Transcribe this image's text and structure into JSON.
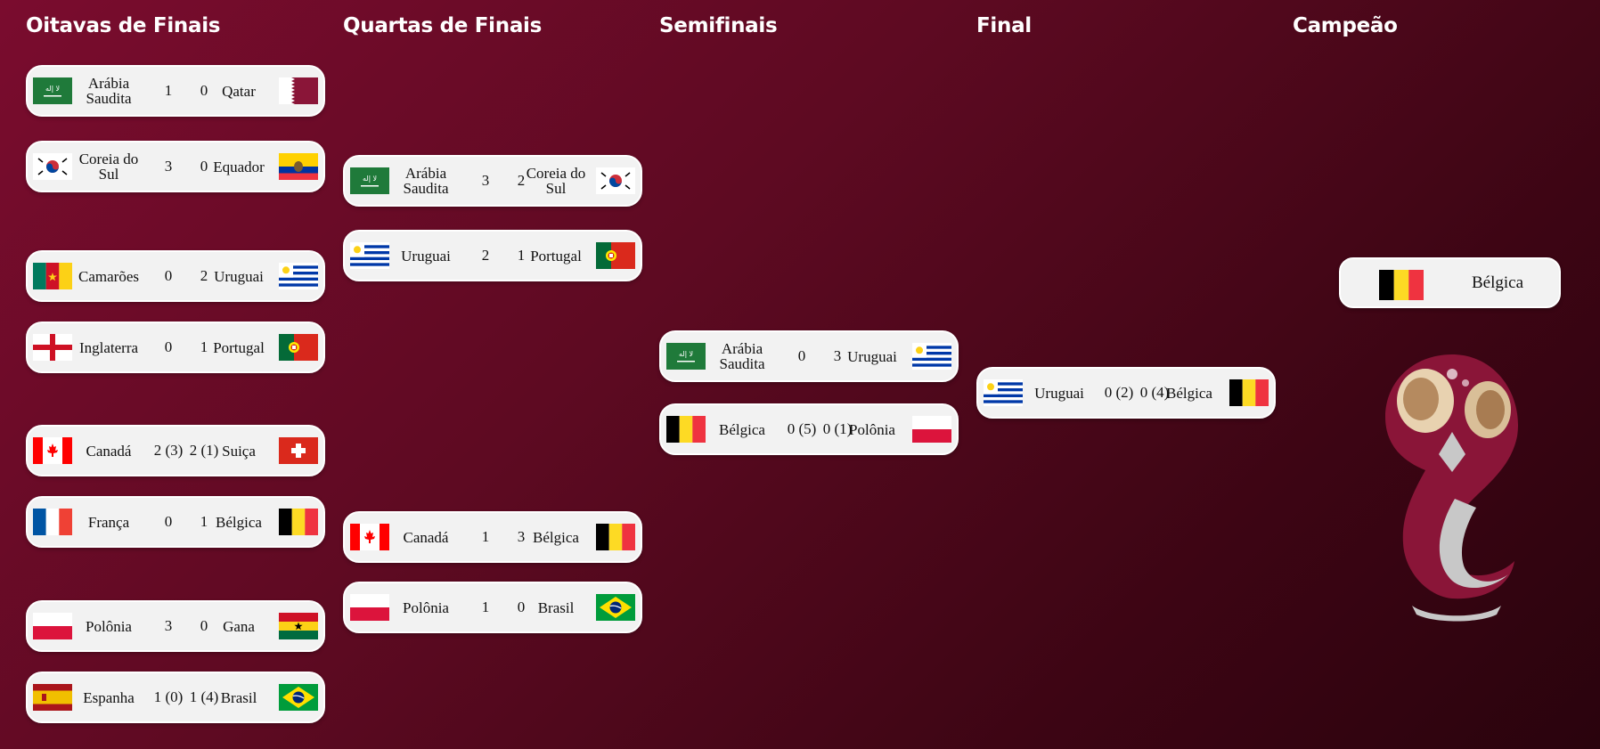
{
  "rounds": [
    "Oitavas de Finais",
    "Quartas de Finais",
    "Semifinais",
    "Final",
    "Campeão"
  ],
  "flags": {
    "ksa": {
      "name": "saudi-arabia-flag-icon",
      "colors": [
        "#1f7a3a",
        "#ffffff"
      ]
    },
    "qat": {
      "name": "qatar-flag-icon",
      "colors": [
        "#8a1538",
        "#ffffff"
      ]
    },
    "kor": {
      "name": "south-korea-flag-icon",
      "colors": [
        "#ffffff",
        "#cd2e3a",
        "#0047a0"
      ]
    },
    "ecu": {
      "name": "ecuador-flag-icon",
      "colors": [
        "#ffd100",
        "#0033a0",
        "#ef3340"
      ]
    },
    "cmr": {
      "name": "cameroon-flag-icon",
      "colors": [
        "#007a5e",
        "#ce1126",
        "#fcd116"
      ]
    },
    "uru": {
      "name": "uruguay-flag-icon",
      "colors": [
        "#ffffff",
        "#0038a8",
        "#fcd116"
      ]
    },
    "eng": {
      "name": "england-flag-icon",
      "colors": [
        "#ffffff",
        "#ce1124"
      ]
    },
    "por": {
      "name": "portugal-flag-icon",
      "colors": [
        "#046a38",
        "#da291c",
        "#ffe900"
      ]
    },
    "can": {
      "name": "canada-flag-icon",
      "colors": [
        "#ff0000",
        "#ffffff"
      ]
    },
    "sui": {
      "name": "switzerland-flag-icon",
      "colors": [
        "#da291c",
        "#ffffff"
      ]
    },
    "fra": {
      "name": "france-flag-icon",
      "colors": [
        "#0055a4",
        "#ffffff",
        "#ef4135"
      ]
    },
    "bel": {
      "name": "belgium-flag-icon",
      "colors": [
        "#000000",
        "#fdda24",
        "#ef3340"
      ]
    },
    "pol": {
      "name": "poland-flag-icon",
      "colors": [
        "#ffffff",
        "#dc143c"
      ]
    },
    "gha": {
      "name": "ghana-flag-icon",
      "colors": [
        "#ce1126",
        "#fcd116",
        "#006b3f",
        "#000000"
      ]
    },
    "esp": {
      "name": "spain-flag-icon",
      "colors": [
        "#aa151b",
        "#f1bf00"
      ]
    },
    "bra": {
      "name": "brazil-flag-icon",
      "colors": [
        "#009c3b",
        "#ffdf00",
        "#002776"
      ]
    }
  },
  "round_of_16": [
    {
      "home": "Arábia Saudita",
      "home_flag": "ksa",
      "home_score": "1",
      "away_score": "0",
      "away": "Qatar",
      "away_flag": "qat"
    },
    {
      "home": "Coreia do Sul",
      "home_flag": "kor",
      "home_score": "3",
      "away_score": "0",
      "away": "Equador",
      "away_flag": "ecu"
    },
    {
      "home": "Camarões",
      "home_flag": "cmr",
      "home_score": "0",
      "away_score": "2",
      "away": "Uruguai",
      "away_flag": "uru"
    },
    {
      "home": "Inglaterra",
      "home_flag": "eng",
      "home_score": "0",
      "away_score": "1",
      "away": "Portugal",
      "away_flag": "por"
    },
    {
      "home": "Canadá",
      "home_flag": "can",
      "home_score": "2 (3)",
      "away_score": "2 (1)",
      "away": "Suiça",
      "away_flag": "sui"
    },
    {
      "home": "França",
      "home_flag": "fra",
      "home_score": "0",
      "away_score": "1",
      "away": "Bélgica",
      "away_flag": "bel"
    },
    {
      "home": "Polônia",
      "home_flag": "pol",
      "home_score": "3",
      "away_score": "0",
      "away": "Gana",
      "away_flag": "gha"
    },
    {
      "home": "Espanha",
      "home_flag": "esp",
      "home_score": "1 (0)",
      "away_score": "1 (4)",
      "away": "Brasil",
      "away_flag": "bra"
    }
  ],
  "quarterfinals": [
    {
      "home": "Arábia Saudita",
      "home_flag": "ksa",
      "home_score": "3",
      "away_score": "2",
      "away": "Coreia do Sul",
      "away_flag": "kor"
    },
    {
      "home": "Uruguai",
      "home_flag": "uru",
      "home_score": "2",
      "away_score": "1",
      "away": "Portugal",
      "away_flag": "por"
    },
    {
      "home": "Canadá",
      "home_flag": "can",
      "home_score": "1",
      "away_score": "3",
      "away": "Bélgica",
      "away_flag": "bel"
    },
    {
      "home": "Polônia",
      "home_flag": "pol",
      "home_score": "1",
      "away_score": "0",
      "away": "Brasil",
      "away_flag": "bra"
    }
  ],
  "semifinals": [
    {
      "home": "Arábia Saudita",
      "home_flag": "ksa",
      "home_score": "0",
      "away_score": "3",
      "away": "Uruguai",
      "away_flag": "uru"
    },
    {
      "home": "Bélgica",
      "home_flag": "bel",
      "home_score": "0 (5)",
      "away_score": "0 (1)",
      "away": "Polônia",
      "away_flag": "pol"
    }
  ],
  "final": [
    {
      "home": "Uruguai",
      "home_flag": "uru",
      "home_score": "0 (2)",
      "away_score": "0 (4)",
      "away": "Bélgica",
      "away_flag": "bel"
    }
  ],
  "champion": {
    "name": "Bélgica",
    "flag": "bel"
  },
  "trophy": {
    "icon": "world-cup-trophy-emblem-icon",
    "colors": [
      "#8a1538",
      "#c8c8c8",
      "#e8d2b0"
    ]
  }
}
